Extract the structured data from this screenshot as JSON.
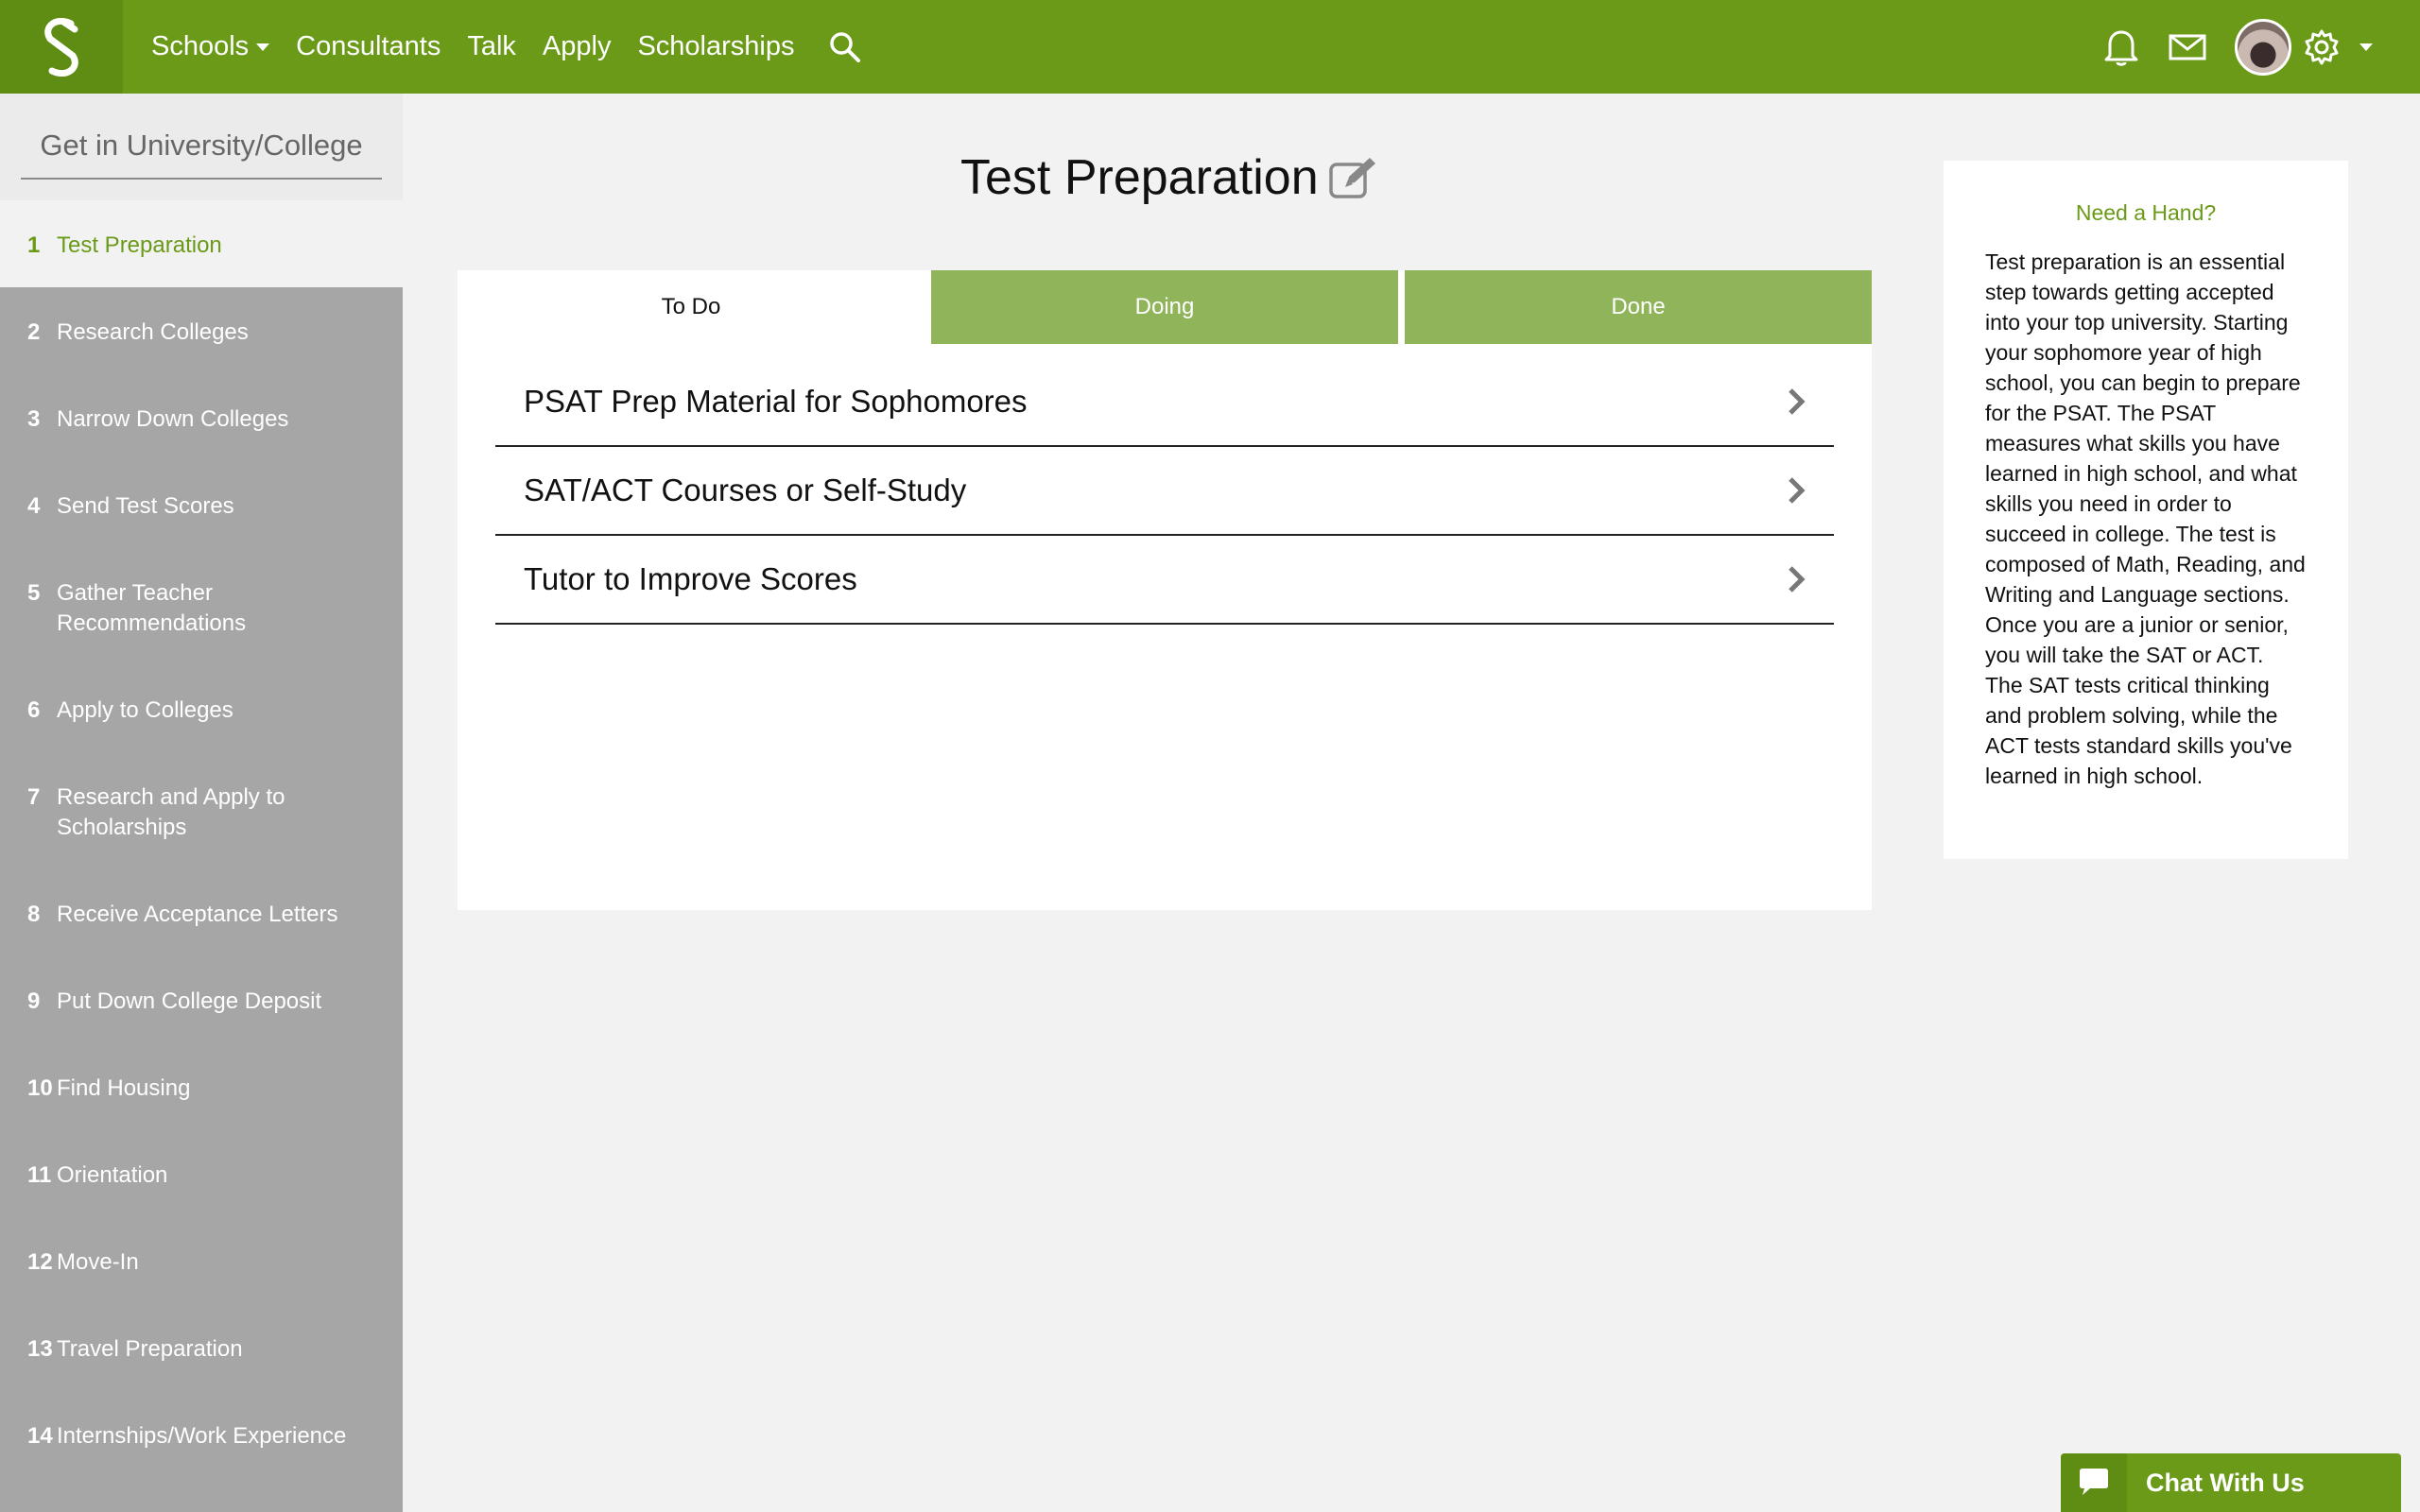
{
  "nav": {
    "links": [
      {
        "label": "Schools",
        "has_dropdown": true
      },
      {
        "label": "Consultants"
      },
      {
        "label": "Talk"
      },
      {
        "label": "Apply"
      },
      {
        "label": "Scholarships"
      }
    ],
    "icons": [
      "search-icon",
      "bell-icon",
      "mail-icon",
      "avatar",
      "gear-icon"
    ],
    "brand_color": "#6a9a18"
  },
  "sidebar": {
    "title": "Get in University/College",
    "items": [
      {
        "num": "1",
        "label": "Test Preparation",
        "active": true
      },
      {
        "num": "2",
        "label": "Research Colleges"
      },
      {
        "num": "3",
        "label": "Narrow Down Colleges"
      },
      {
        "num": "4",
        "label": "Send Test Scores"
      },
      {
        "num": "5",
        "label": "Gather Teacher Recommendations"
      },
      {
        "num": "6",
        "label": "Apply to Colleges"
      },
      {
        "num": "7",
        "label": "Research and Apply to Scholarships"
      },
      {
        "num": "8",
        "label": "Receive Acceptance Letters"
      },
      {
        "num": "9",
        "label": "Put Down College Deposit"
      },
      {
        "num": "10",
        "label": "Find Housing"
      },
      {
        "num": "11",
        "label": "Orientation"
      },
      {
        "num": "12",
        "label": "Move-In"
      },
      {
        "num": "13",
        "label": "Travel Preparation"
      },
      {
        "num": "14",
        "label": "Internships/Work Experience"
      }
    ]
  },
  "main": {
    "title": "Test Preparation",
    "tabs": [
      {
        "label": "To Do",
        "active": true
      },
      {
        "label": "Doing"
      },
      {
        "label": "Done"
      }
    ],
    "tasks": [
      {
        "label": "PSAT Prep Material for Sophomores"
      },
      {
        "label": "SAT/ACT Courses or Self-Study"
      },
      {
        "label": "Tutor to Improve Scores"
      }
    ]
  },
  "help": {
    "title": "Need a Hand?",
    "text": "Test preparation is an essential step towards getting accepted into your top university. Starting your sophomore year of high school, you can begin to prepare for the PSAT. The PSAT measures what skills you have learned in high school, and what skills you need in order to succeed in college. The test is composed of Math, Reading, and Writing and Language sections. Once you are a junior or senior, you will take the SAT or ACT. The SAT tests critical thinking and problem solving, while the ACT tests standard skills you've learned in high school."
  },
  "chat": {
    "label": "Chat With Us"
  }
}
